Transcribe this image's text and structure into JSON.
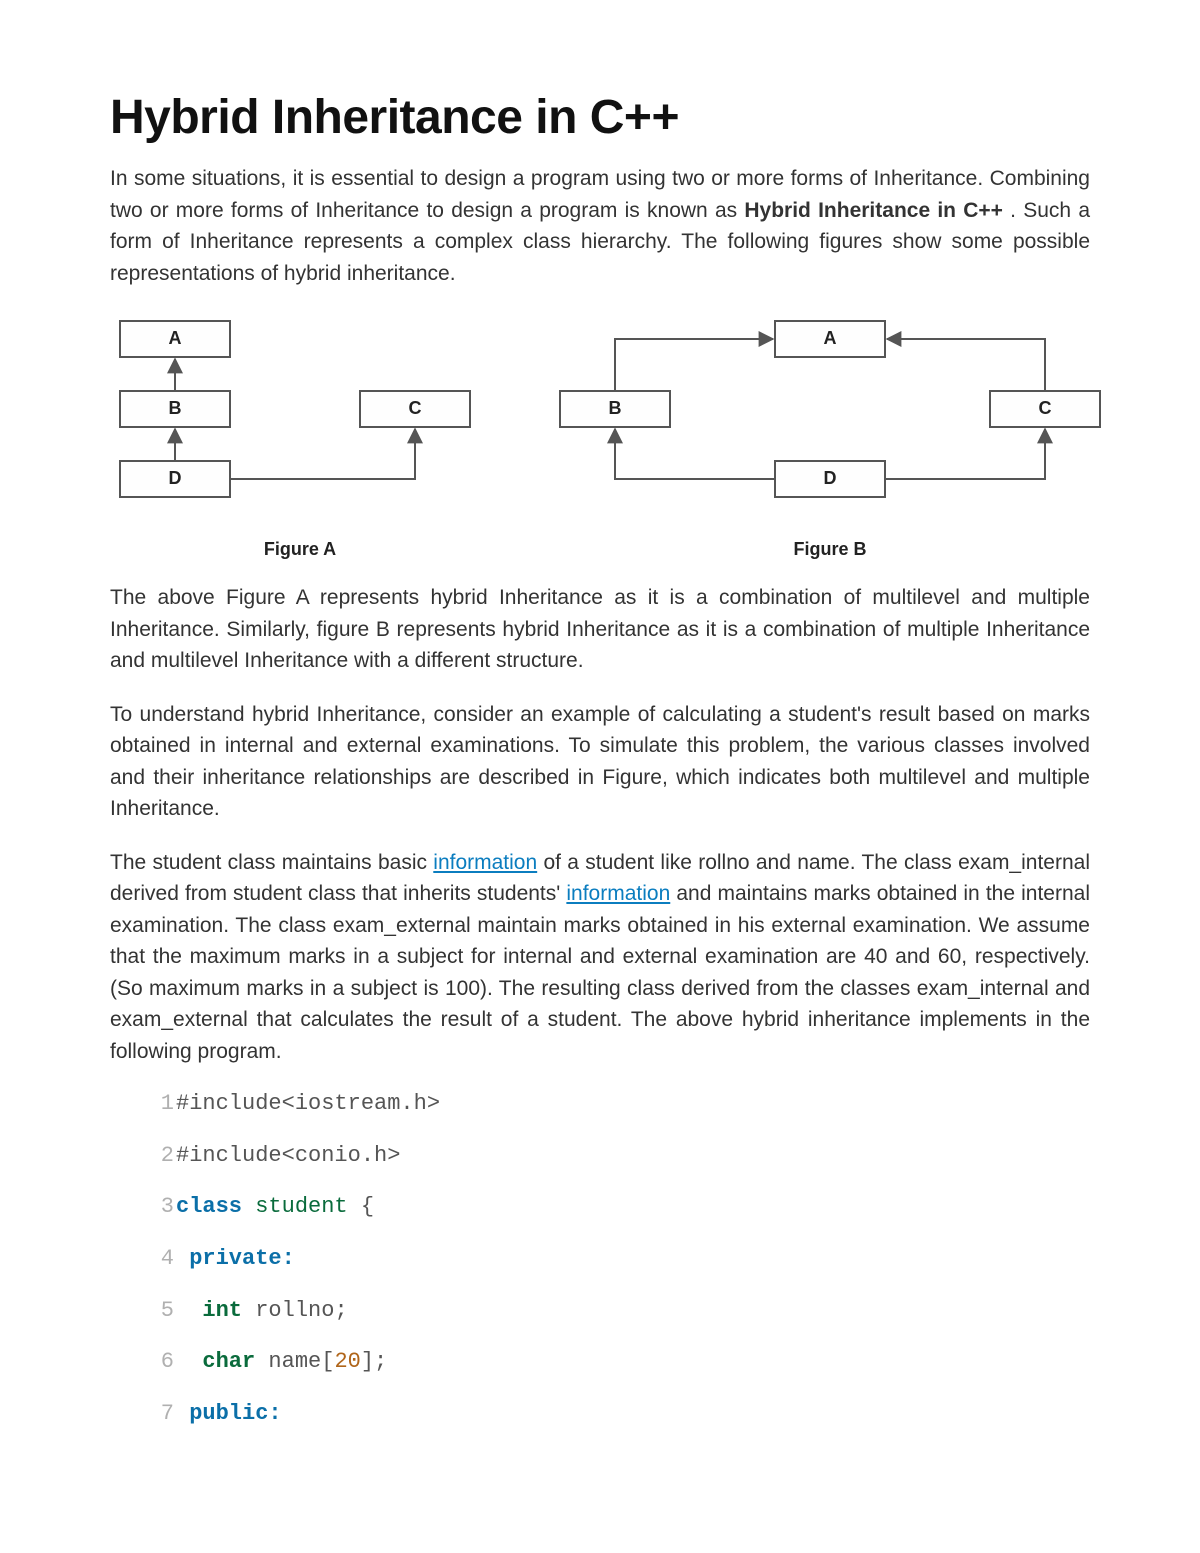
{
  "title": "Hybrid Inheritance in C++",
  "intro": {
    "pre": "In some situations, it is essential to design a program using two or more forms of Inheritance. Combining two or more forms of Inheritance to design a program is known as ",
    "bold": "Hybrid Inheritance in C++",
    "post": ". Such a form of Inheritance represents a complex class hierarchy. The following figures show some possible representations of hybrid inheritance."
  },
  "figA": {
    "caption": "Figure A",
    "labels": {
      "A": "A",
      "B": "B",
      "C": "C",
      "D": "D"
    }
  },
  "figB": {
    "caption": "Figure B",
    "labels": {
      "A": "A",
      "B": "B",
      "C": "C",
      "D": "D"
    }
  },
  "para2": "The above Figure A represents hybrid Inheritance as it is a combination of multilevel and multiple Inheritance. Similarly, figure B represents hybrid Inheritance as it is a combination of multiple Inheritance and multilevel Inheritance with a different structure.",
  "para3": "To understand hybrid Inheritance, consider an example of calculating a student's result based on marks obtained in internal and external examinations. To simulate this problem, the various classes involved and their inheritance relationships are described in Figure, which indicates both multilevel and multiple Inheritance.",
  "para4": {
    "s1": "The student class maintains basic ",
    "link1": "information",
    "s2": " of a student like rollno and name. The class exam_internal derived from student class that inherits students' ",
    "link2": "information",
    "s3": " and maintains marks obtained in the internal examination. The class exam_external maintain marks obtained in his external examination. We assume that the maximum marks in a subject for internal and external examination are 40 and 60, respectively. (So maximum marks in a subject is 100). The resulting class derived from the classes exam_internal and exam_external that calculates the result of a student. The above hybrid inheritance implements in the following program."
  },
  "code": [
    {
      "n": "1",
      "tokens": [
        {
          "cls": "plain",
          "t": "#include<iostream.h>"
        }
      ]
    },
    {
      "n": "2",
      "tokens": [
        {
          "cls": "plain",
          "t": "#include<conio.h>"
        }
      ]
    },
    {
      "n": "3",
      "tokens": [
        {
          "cls": "kw",
          "t": "class"
        },
        {
          "cls": "plain",
          "t": " "
        },
        {
          "cls": "typ",
          "t": "student"
        },
        {
          "cls": "plain",
          "t": " "
        },
        {
          "cls": "punc",
          "t": "{"
        }
      ]
    },
    {
      "n": "4",
      "tokens": [
        {
          "cls": "plain",
          "t": " "
        },
        {
          "cls": "kw",
          "t": "private"
        },
        {
          "cls": "kw",
          "t": ":"
        }
      ]
    },
    {
      "n": "5",
      "tokens": [
        {
          "cls": "plain",
          "t": "  "
        },
        {
          "cls": "kw2",
          "t": "int"
        },
        {
          "cls": "plain",
          "t": " "
        },
        {
          "cls": "id",
          "t": "rollno"
        },
        {
          "cls": "punc",
          "t": ";"
        }
      ]
    },
    {
      "n": "6",
      "tokens": [
        {
          "cls": "plain",
          "t": "  "
        },
        {
          "cls": "kw2",
          "t": "char"
        },
        {
          "cls": "plain",
          "t": " "
        },
        {
          "cls": "id",
          "t": "name"
        },
        {
          "cls": "punc",
          "t": "["
        },
        {
          "cls": "num",
          "t": "20"
        },
        {
          "cls": "punc",
          "t": "]"
        },
        {
          "cls": "punc",
          "t": ";"
        }
      ]
    },
    {
      "n": "7",
      "tokens": [
        {
          "cls": "plain",
          "t": " "
        },
        {
          "cls": "kw",
          "t": "public"
        },
        {
          "cls": "kw",
          "t": ":"
        }
      ]
    }
  ]
}
